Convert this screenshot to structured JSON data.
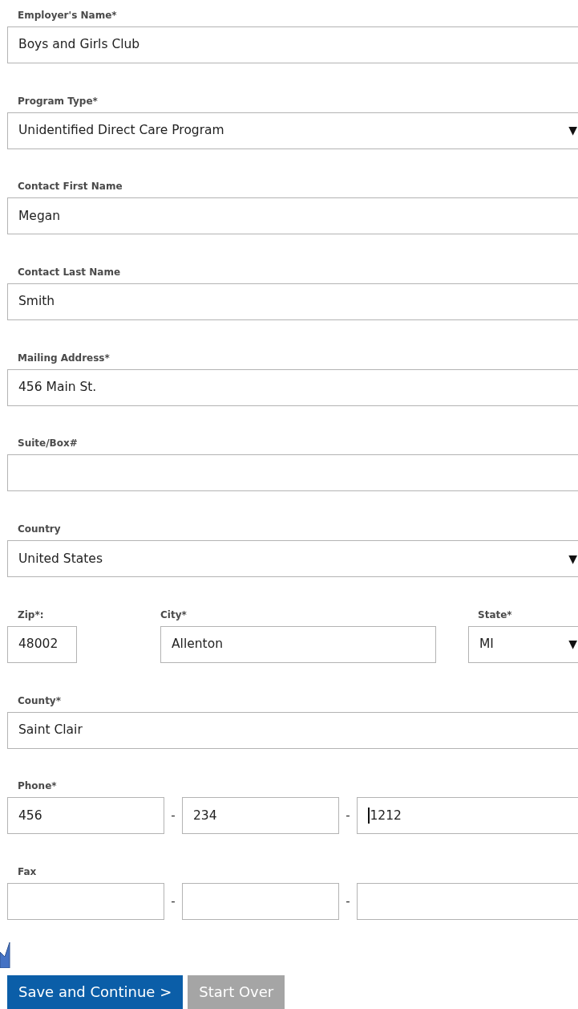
{
  "fields": [
    {
      "kind": "text",
      "label": "Employer's Name*",
      "value": "Boys and Girls Club"
    },
    {
      "kind": "select",
      "label": "Program Type*",
      "value": "Unidentified Direct Care Program",
      "arrow": "▼"
    },
    {
      "kind": "text",
      "label": "Contact First Name",
      "value": "Megan"
    },
    {
      "kind": "text",
      "label": "Contact Last Name",
      "value": "Smith"
    },
    {
      "kind": "text",
      "label": "Mailing Address*",
      "value": "456 Main St."
    },
    {
      "kind": "text",
      "label": "Suite/Box#"
    },
    {
      "kind": "select",
      "label": "Country",
      "value": "United States",
      "arrow": "▼"
    },
    {
      "kind": "address_row",
      "parts": [
        {
          "label": "Zip*:",
          "value": "48002"
        },
        {
          "label": "City*",
          "value": "Allenton"
        },
        {
          "label": "State*",
          "value": "MI",
          "arrow": "▼"
        }
      ]
    },
    {
      "kind": "text",
      "label": "County*",
      "value": "Saint Clair"
    },
    {
      "kind": "phone",
      "label": "Phone*",
      "separators": [
        "-",
        "-"
      ],
      "parts": [
        {
          "value": "456"
        },
        {
          "value": "234"
        },
        {
          "value": "1212",
          "focused": true
        }
      ]
    },
    {
      "kind": "phone",
      "label": "Fax",
      "separators": [
        "-",
        "-"
      ]
    }
  ],
  "buttons": [
    {
      "label": "Save and Continue >",
      "kind": "primary"
    },
    {
      "label": "Start Over",
      "kind": "secondary"
    }
  ]
}
